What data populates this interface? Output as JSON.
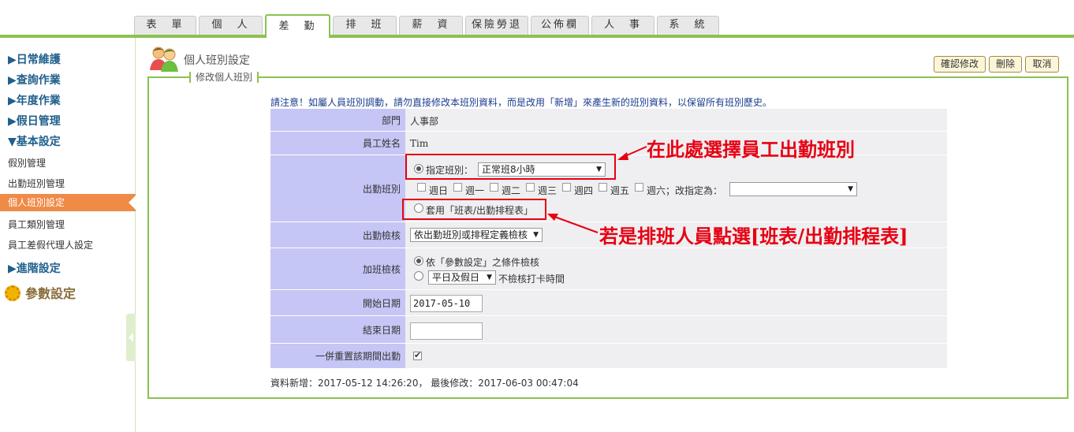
{
  "tabs": [
    {
      "label": "表　單"
    },
    {
      "label": "個　人"
    },
    {
      "label": "差　勤"
    },
    {
      "label": "排　班"
    },
    {
      "label": "薪　資"
    },
    {
      "label": "保險勞退"
    },
    {
      "label": "公佈欄"
    },
    {
      "label": "人　事"
    },
    {
      "label": "系　統"
    }
  ],
  "sidebar": {
    "headings": [
      "▶日常維護",
      "▶查詢作業",
      "▶年度作業",
      "▶假日管理",
      "▼基本設定"
    ],
    "subitems": [
      "假別管理",
      "出勤班別管理"
    ],
    "active_item": "個人班別設定",
    "subitems_after": [
      "員工類別管理",
      "員工差假代理人設定"
    ],
    "advanced": "▶進階設定",
    "params": "參數設定"
  },
  "header": {
    "title": "個人班別設定",
    "buttons": {
      "confirm": "確認修改",
      "delete": "刪除",
      "cancel": "取消"
    }
  },
  "panel": {
    "legend": "修改個人班別",
    "notice": "請注意！如屬人員班別調動，請勿直接修改本班別資料，而是改用「新增」來產生新的班別資料，以保留所有班別歷史。"
  },
  "form": {
    "dept": {
      "label": "部門",
      "value": "人事部"
    },
    "name": {
      "label": "員工姓名",
      "value": "Tim"
    },
    "shift": {
      "label": "出勤班別",
      "assign_label": "指定班別：",
      "assign_value": "正常班8小時",
      "weekdays": [
        "週日",
        "週一",
        "週二",
        "週三",
        "週四",
        "週五",
        "週六"
      ],
      "change_label": "；改指定為：",
      "apply_label": "套用「班表/出勤排程表」"
    },
    "check": {
      "label": "出勤檢核",
      "value": "依出勤班別或排程定義檢核"
    },
    "overtime": {
      "label": "加班檢核",
      "opt1": "依「參數設定」之條件檢核",
      "opt2_select": "平日及假日",
      "opt2_text": "不檢核打卡時間"
    },
    "start": {
      "label": "開始日期",
      "value": "2017-05-10"
    },
    "end": {
      "label": "結束日期",
      "value": ""
    },
    "reset": {
      "label": "一併重置該期間出勤",
      "checked": true
    }
  },
  "meta": "資料新增：2017-05-12 14:26:20， 最後修改：2017-06-03 00:47:04",
  "annotations": {
    "text1": "在此處選擇員工出勤班別",
    "text2": "若是排班人員點選[班表/出勤排程表]"
  },
  "colors": {
    "accent": "#8cc152",
    "label_bg": "#c5c6f5",
    "value_bg": "#efeef0",
    "annotation": "#e60012",
    "active_side": "#f08a47"
  }
}
